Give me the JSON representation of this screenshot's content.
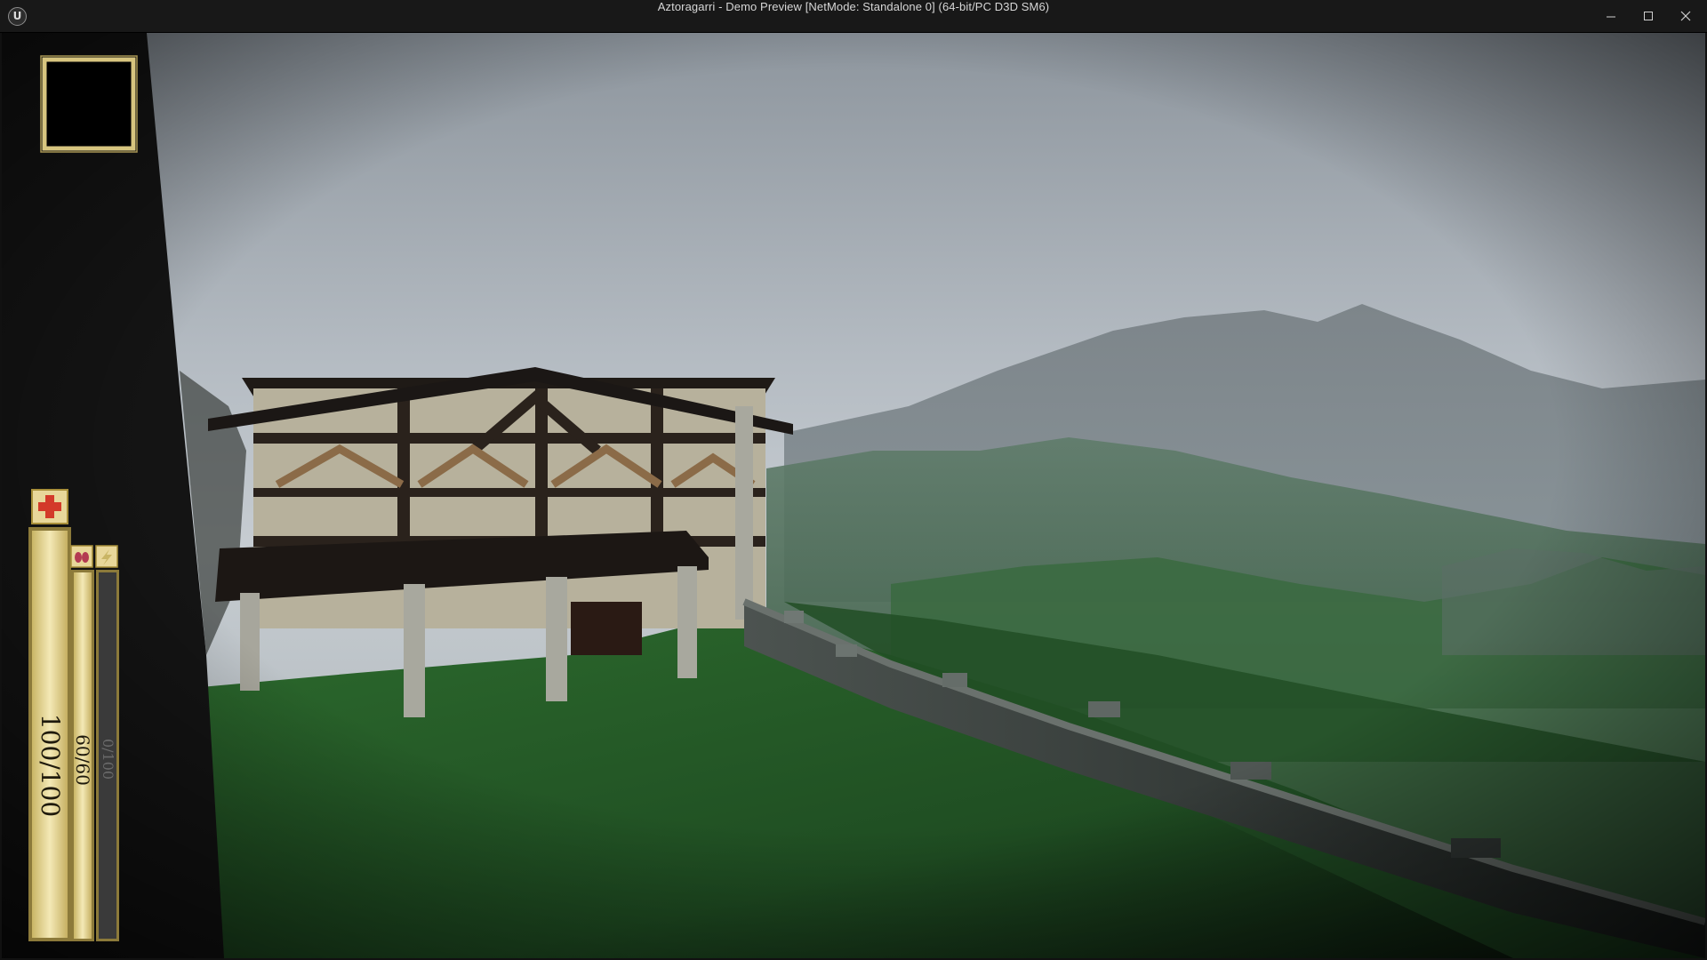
{
  "window": {
    "title": "Aztoragarri - Demo Preview [NetMode: Standalone 0]  (64-bit/PC D3D SM6)",
    "app_icon": "unreal-engine-logo",
    "controls": {
      "minimize": "minimize-icon",
      "maximize": "maximize-icon",
      "close": "close-icon"
    }
  },
  "hud": {
    "portrait_frame": {
      "icon": "empty-portrait-frame"
    },
    "health": {
      "icon": "red-cross-icon",
      "current": 100,
      "max": 100,
      "text": "100/100",
      "fraction": 1.0,
      "color": "#f0e2a8"
    },
    "stamina": {
      "icon": "lungs-icon",
      "current": 60,
      "max": 60,
      "text": "60/60",
      "fraction": 1.0,
      "color": "#eee0a6"
    },
    "mana": {
      "icon": "lightning-icon",
      "current": 0,
      "max": 100,
      "text": "0/100",
      "fraction": 0.0,
      "color": "#4a4a4a"
    }
  },
  "scene": {
    "description_colors": {
      "sky": "#b9c0c6",
      "grass": "#2c6a2c",
      "hud_gold": "#d9c77a"
    }
  }
}
